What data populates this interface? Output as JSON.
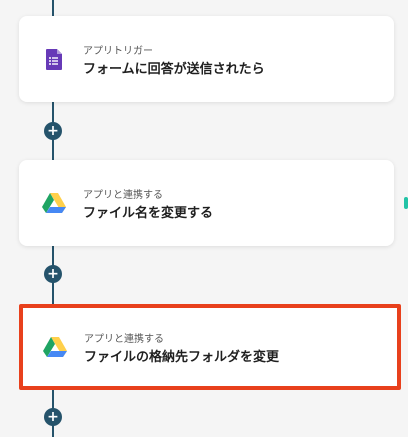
{
  "colors": {
    "connector": "#25536b",
    "selected_border": "#e8401c",
    "forms_icon": "#673ab7",
    "drive_green": "#1fa463",
    "drive_yellow": "#ffd04b",
    "drive_blue": "#4688f4"
  },
  "steps": [
    {
      "icon": "google-forms-icon",
      "subtitle": "アプリトリガー",
      "title": "フォームに回答が送信されたら",
      "selected": false
    },
    {
      "icon": "google-drive-icon",
      "subtitle": "アプリと連携する",
      "title": "ファイル名を変更する",
      "selected": false
    },
    {
      "icon": "google-drive-icon",
      "subtitle": "アプリと連携する",
      "title": "ファイルの格納先フォルダを変更",
      "selected": true
    }
  ],
  "add_button_symbol": "+"
}
